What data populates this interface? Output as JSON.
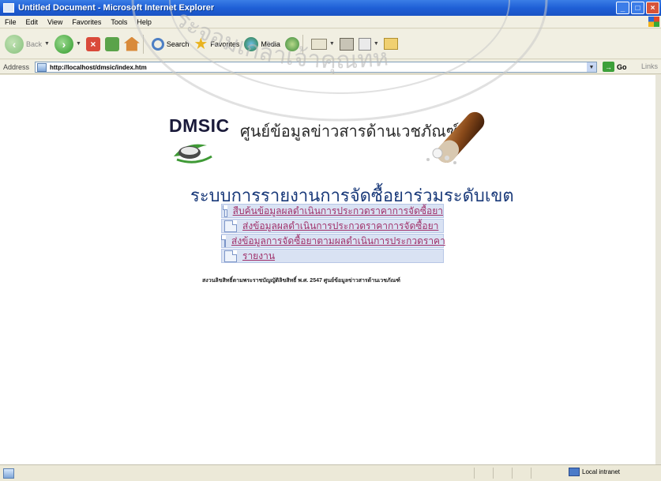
{
  "window": {
    "title": "Untitled Document - Microsoft Internet Explorer",
    "controls": [
      "_",
      "□",
      "×"
    ]
  },
  "menubar": [
    "File",
    "Edit",
    "View",
    "Favorites",
    "Tools",
    "Help"
  ],
  "toolbar": {
    "back_label": "Back",
    "search_label": "Search",
    "favorites_label": "Favorites",
    "media_label": "Media"
  },
  "address": {
    "label": "Address",
    "url": "http://localhost/dmsic/index.htm",
    "go_label": "Go",
    "links_label": "Links"
  },
  "page": {
    "logo_text": "DMSIC",
    "center_name": "ศูนย์ข้อมูลข่าวสารด้านเวชภัณฑ์",
    "system_title": "ระบบการรายงานการจัดซื้อยาร่วมระดับเขต",
    "menu_items": [
      "สืบค้นข้อมูลผลดำเนินการประกวดราคาการจัดซื้อยา",
      "ส่งข้อมูลผลดำเนินการประกวดราคาการจัดซื้อยา",
      "ส่งข้อมูลการจัดซื้อยาตามผลดำเนินการประกวดราคา",
      "รายงาน"
    ],
    "footer": "สงวนลิขสิทธิ์ตามพระราชบัญญัติลิขสิทธิ์ พ.ศ. 2547 ศูนย์ข้อมูลข่าวสารด้านเวชภัณฑ์"
  },
  "watermark_text": "ระจอมเกล้าเจ้าคุณทห",
  "statusbar": {
    "zone": "Local intranet"
  }
}
